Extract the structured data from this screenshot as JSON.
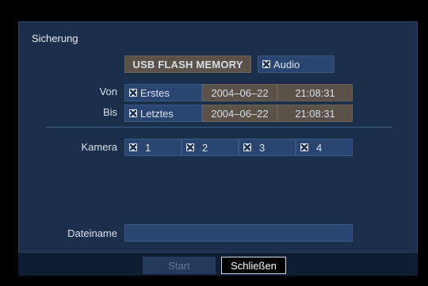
{
  "dialog": {
    "title": "Sicherung"
  },
  "device": {
    "label": "USB FLASH MEMORY"
  },
  "audio": {
    "label": "Audio",
    "checked": true
  },
  "range": {
    "from_label": "Von",
    "to_label": "Bis",
    "from": {
      "mode": "Erstes",
      "date": "2004–06–22",
      "time": "21:08:31"
    },
    "to": {
      "mode": "Letztes",
      "date": "2004–06–22",
      "time": "21:08:31"
    }
  },
  "cameras": {
    "label": "Kamera",
    "items": [
      "1",
      "2",
      "3",
      "4"
    ]
  },
  "filename": {
    "label": "Dateiname",
    "value": ""
  },
  "buttons": {
    "start": "Start",
    "close": "Schließen"
  },
  "colors": {
    "panel": "#1b2e4a",
    "field": "#2a4670",
    "value_field": "#5a5248"
  }
}
